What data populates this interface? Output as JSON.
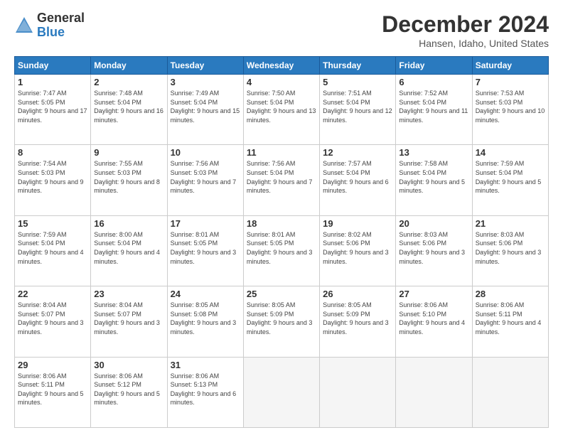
{
  "header": {
    "logo_general": "General",
    "logo_blue": "Blue",
    "month_title": "December 2024",
    "location": "Hansen, Idaho, United States"
  },
  "weekdays": [
    "Sunday",
    "Monday",
    "Tuesday",
    "Wednesday",
    "Thursday",
    "Friday",
    "Saturday"
  ],
  "weeks": [
    [
      {
        "day": "1",
        "sunrise": "Sunrise: 7:47 AM",
        "sunset": "Sunset: 5:05 PM",
        "daylight": "Daylight: 9 hours and 17 minutes."
      },
      {
        "day": "2",
        "sunrise": "Sunrise: 7:48 AM",
        "sunset": "Sunset: 5:04 PM",
        "daylight": "Daylight: 9 hours and 16 minutes."
      },
      {
        "day": "3",
        "sunrise": "Sunrise: 7:49 AM",
        "sunset": "Sunset: 5:04 PM",
        "daylight": "Daylight: 9 hours and 15 minutes."
      },
      {
        "day": "4",
        "sunrise": "Sunrise: 7:50 AM",
        "sunset": "Sunset: 5:04 PM",
        "daylight": "Daylight: 9 hours and 13 minutes."
      },
      {
        "day": "5",
        "sunrise": "Sunrise: 7:51 AM",
        "sunset": "Sunset: 5:04 PM",
        "daylight": "Daylight: 9 hours and 12 minutes."
      },
      {
        "day": "6",
        "sunrise": "Sunrise: 7:52 AM",
        "sunset": "Sunset: 5:04 PM",
        "daylight": "Daylight: 9 hours and 11 minutes."
      },
      {
        "day": "7",
        "sunrise": "Sunrise: 7:53 AM",
        "sunset": "Sunset: 5:03 PM",
        "daylight": "Daylight: 9 hours and 10 minutes."
      }
    ],
    [
      {
        "day": "8",
        "sunrise": "Sunrise: 7:54 AM",
        "sunset": "Sunset: 5:03 PM",
        "daylight": "Daylight: 9 hours and 9 minutes."
      },
      {
        "day": "9",
        "sunrise": "Sunrise: 7:55 AM",
        "sunset": "Sunset: 5:03 PM",
        "daylight": "Daylight: 9 hours and 8 minutes."
      },
      {
        "day": "10",
        "sunrise": "Sunrise: 7:56 AM",
        "sunset": "Sunset: 5:03 PM",
        "daylight": "Daylight: 9 hours and 7 minutes."
      },
      {
        "day": "11",
        "sunrise": "Sunrise: 7:56 AM",
        "sunset": "Sunset: 5:04 PM",
        "daylight": "Daylight: 9 hours and 7 minutes."
      },
      {
        "day": "12",
        "sunrise": "Sunrise: 7:57 AM",
        "sunset": "Sunset: 5:04 PM",
        "daylight": "Daylight: 9 hours and 6 minutes."
      },
      {
        "day": "13",
        "sunrise": "Sunrise: 7:58 AM",
        "sunset": "Sunset: 5:04 PM",
        "daylight": "Daylight: 9 hours and 5 minutes."
      },
      {
        "day": "14",
        "sunrise": "Sunrise: 7:59 AM",
        "sunset": "Sunset: 5:04 PM",
        "daylight": "Daylight: 9 hours and 5 minutes."
      }
    ],
    [
      {
        "day": "15",
        "sunrise": "Sunrise: 7:59 AM",
        "sunset": "Sunset: 5:04 PM",
        "daylight": "Daylight: 9 hours and 4 minutes."
      },
      {
        "day": "16",
        "sunrise": "Sunrise: 8:00 AM",
        "sunset": "Sunset: 5:04 PM",
        "daylight": "Daylight: 9 hours and 4 minutes."
      },
      {
        "day": "17",
        "sunrise": "Sunrise: 8:01 AM",
        "sunset": "Sunset: 5:05 PM",
        "daylight": "Daylight: 9 hours and 3 minutes."
      },
      {
        "day": "18",
        "sunrise": "Sunrise: 8:01 AM",
        "sunset": "Sunset: 5:05 PM",
        "daylight": "Daylight: 9 hours and 3 minutes."
      },
      {
        "day": "19",
        "sunrise": "Sunrise: 8:02 AM",
        "sunset": "Sunset: 5:06 PM",
        "daylight": "Daylight: 9 hours and 3 minutes."
      },
      {
        "day": "20",
        "sunrise": "Sunrise: 8:03 AM",
        "sunset": "Sunset: 5:06 PM",
        "daylight": "Daylight: 9 hours and 3 minutes."
      },
      {
        "day": "21",
        "sunrise": "Sunrise: 8:03 AM",
        "sunset": "Sunset: 5:06 PM",
        "daylight": "Daylight: 9 hours and 3 minutes."
      }
    ],
    [
      {
        "day": "22",
        "sunrise": "Sunrise: 8:04 AM",
        "sunset": "Sunset: 5:07 PM",
        "daylight": "Daylight: 9 hours and 3 minutes."
      },
      {
        "day": "23",
        "sunrise": "Sunrise: 8:04 AM",
        "sunset": "Sunset: 5:07 PM",
        "daylight": "Daylight: 9 hours and 3 minutes."
      },
      {
        "day": "24",
        "sunrise": "Sunrise: 8:05 AM",
        "sunset": "Sunset: 5:08 PM",
        "daylight": "Daylight: 9 hours and 3 minutes."
      },
      {
        "day": "25",
        "sunrise": "Sunrise: 8:05 AM",
        "sunset": "Sunset: 5:09 PM",
        "daylight": "Daylight: 9 hours and 3 minutes."
      },
      {
        "day": "26",
        "sunrise": "Sunrise: 8:05 AM",
        "sunset": "Sunset: 5:09 PM",
        "daylight": "Daylight: 9 hours and 3 minutes."
      },
      {
        "day": "27",
        "sunrise": "Sunrise: 8:06 AM",
        "sunset": "Sunset: 5:10 PM",
        "daylight": "Daylight: 9 hours and 4 minutes."
      },
      {
        "day": "28",
        "sunrise": "Sunrise: 8:06 AM",
        "sunset": "Sunset: 5:11 PM",
        "daylight": "Daylight: 9 hours and 4 minutes."
      }
    ],
    [
      {
        "day": "29",
        "sunrise": "Sunrise: 8:06 AM",
        "sunset": "Sunset: 5:11 PM",
        "daylight": "Daylight: 9 hours and 5 minutes."
      },
      {
        "day": "30",
        "sunrise": "Sunrise: 8:06 AM",
        "sunset": "Sunset: 5:12 PM",
        "daylight": "Daylight: 9 hours and 5 minutes."
      },
      {
        "day": "31",
        "sunrise": "Sunrise: 8:06 AM",
        "sunset": "Sunset: 5:13 PM",
        "daylight": "Daylight: 9 hours and 6 minutes."
      },
      null,
      null,
      null,
      null
    ]
  ]
}
